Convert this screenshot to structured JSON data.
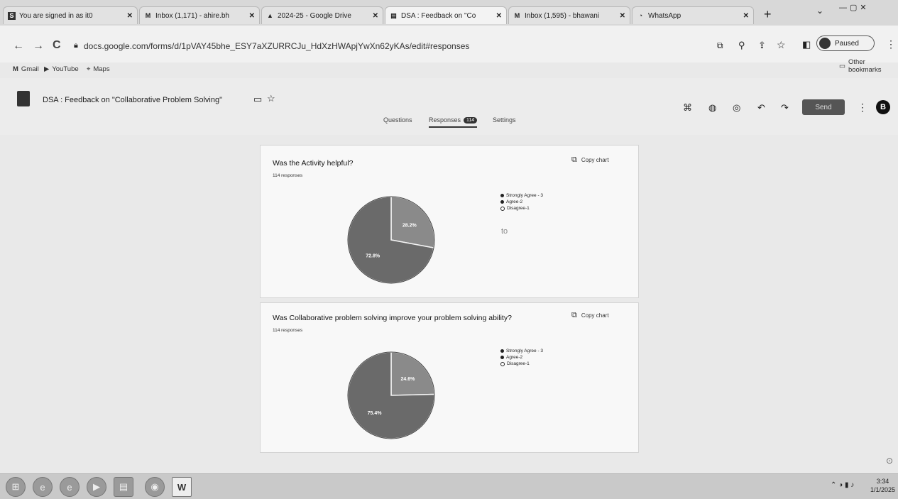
{
  "browser": {
    "tabs": [
      {
        "label": "You are signed in as it0",
        "icon": "google-classroom-icon",
        "icon_glyph": "S"
      },
      {
        "label": "Inbox (1,171) - ahire.bh",
        "icon": "gmail-icon",
        "icon_glyph": "M"
      },
      {
        "label": "2024-25 - Google Drive",
        "icon": "google-drive-icon",
        "icon_glyph": "▲"
      },
      {
        "label": "DSA : Feedback on \"Co",
        "icon": "google-forms-icon",
        "icon_glyph": "▤"
      },
      {
        "label": "Inbox (1,595) - bhawani",
        "icon": "gmail-icon",
        "icon_glyph": "M"
      },
      {
        "label": "WhatsApp",
        "icon": "whatsapp-icon",
        "icon_glyph": "◔"
      }
    ],
    "new_tab": "+",
    "url": "docs.google.com/forms/d/1pVAY45bhe_ESY7aXZURRCJu_HdXzHWApjYwXn62yKAs/edit#responses",
    "profile_status": "Paused",
    "bookmarks": [
      {
        "label": "Gmail",
        "icon": "gmail-icon",
        "glyph": "M"
      },
      {
        "label": "YouTube",
        "icon": "youtube-icon",
        "glyph": "▶"
      },
      {
        "label": "Maps",
        "icon": "maps-icon",
        "glyph": "⌖"
      }
    ],
    "other_bookmarks": "Other bookmarks"
  },
  "form": {
    "title": "DSA : Feedback on \"Collaborative Problem Solving\"",
    "send_label": "Send",
    "avatar_initial": "B",
    "tabs": {
      "questions": "Questions",
      "responses": "Responses",
      "responses_count": "114",
      "settings": "Settings"
    }
  },
  "questions": [
    {
      "title": "Was the Activity helpful?",
      "responses": "114 responses",
      "copy_label": "Copy chart",
      "legend": [
        "Strongly Agree - 3",
        "Agree-2",
        "Disagree-1"
      ],
      "extra_text": "to"
    },
    {
      "title": "Was Collaborative problem solving improve your problem solving ability?",
      "responses": "114 responses",
      "copy_label": "Copy chart",
      "legend": [
        "Strongly Agree - 3",
        "Agree-2",
        "Disagree-1"
      ]
    }
  ],
  "chart_data": [
    {
      "type": "pie",
      "title": "Was the Activity helpful?",
      "categories": [
        "Strongly Agree - 3",
        "Agree-2",
        "Disagree-1"
      ],
      "values": [
        72.8,
        28.2,
        0
      ],
      "labels": [
        "72.8%",
        "28.2%",
        ""
      ],
      "colors": [
        "#6a6a6a",
        "#8a8a8a",
        "#cfcfcf"
      ]
    },
    {
      "type": "pie",
      "title": "Was Collaborative problem solving improve your problem solving ability?",
      "categories": [
        "Strongly Agree - 3",
        "Agree-2",
        "Disagree-1"
      ],
      "values": [
        75.4,
        24.6,
        0
      ],
      "labels": [
        "75.4%",
        "24.6%",
        ""
      ],
      "colors": [
        "#6a6a6a",
        "#8a8a8a",
        "#cfcfcf"
      ]
    }
  ],
  "taskbar": {
    "time": "3:34",
    "date": "1/1/2025"
  }
}
